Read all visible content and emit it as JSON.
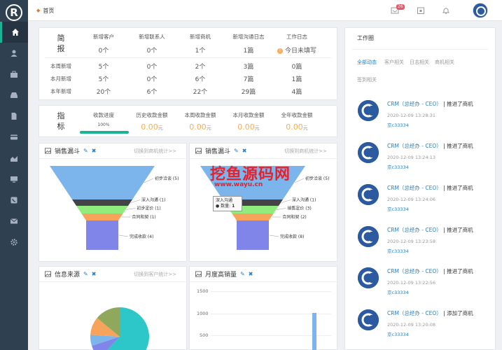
{
  "logo": "R",
  "nav": [
    "home-icon",
    "user-icon",
    "briefcase-icon",
    "inbox-icon",
    "document-icon",
    "credit-card-icon",
    "area-chart-icon",
    "monitor-icon",
    "phone-icon",
    "envelope-icon",
    "gear-icon"
  ],
  "topbar": {
    "home_tab": "首页",
    "badge": "26"
  },
  "summary": {
    "label": [
      "简",
      "报"
    ],
    "columns": [
      "新增客户",
      "新增联系人",
      "新增商机",
      "新增沟通日志",
      "工作日志"
    ],
    "today": [
      "0个",
      "0个",
      "1个",
      "1篇"
    ],
    "today_worklog": "今日未填写",
    "rows": [
      {
        "label": "本周新增",
        "values": [
          "5个",
          "0个",
          "2个",
          "3篇",
          "0篇"
        ]
      },
      {
        "label": "本月新增",
        "values": [
          "5个",
          "0个",
          "6个",
          "7篇",
          "1篇"
        ]
      },
      {
        "label": "本年新增",
        "values": [
          "20个",
          "6个",
          "22个",
          "29篇",
          "4篇"
        ]
      }
    ]
  },
  "indicators": {
    "label": [
      "指",
      "标"
    ],
    "columns": [
      "收款进度",
      "历史收款金额",
      "本周收款金额",
      "本月收款金额",
      "全年收款金额"
    ],
    "progress_text": "100%",
    "progress_fraction": 1.0,
    "values": [
      "0.00",
      "0.00",
      "0.00",
      "0.00"
    ],
    "unit": "元"
  },
  "funnel1": {
    "title": "销售漏斗",
    "link": "切换到商机统计>>",
    "stages": [
      {
        "label": "初步洽谈 (5)",
        "value": 5,
        "color": "#7cb5ec"
      },
      {
        "label": "深入沟通 (1)",
        "value": 1,
        "color": "#434348"
      },
      {
        "label": "初步定价 (1)",
        "value": 1,
        "color": "#90ed7d"
      },
      {
        "label": "合同和契 (1)",
        "value": 1,
        "color": "#f7a35c"
      },
      {
        "label": "完成收款 (4)",
        "value": 4,
        "color": "#8085e9"
      }
    ]
  },
  "funnel2": {
    "title": "销售漏斗",
    "link": "切换到商机统计>>",
    "stages": [
      {
        "label": "初步洽谈 (5)",
        "value": 5,
        "color": "#7cb5ec"
      },
      {
        "label": "深入沟通 (1)",
        "value": 1,
        "color": "#434348"
      },
      {
        "label": "销售定价 (3)",
        "value": 3,
        "color": "#90ed7d"
      },
      {
        "label": "合同和契 (2)",
        "value": 2,
        "color": "#f7a35c"
      },
      {
        "label": "完成收款 (8)",
        "value": 8,
        "color": "#8085e9"
      }
    ],
    "tooltip": {
      "title": "深入沟通",
      "label": "数量:",
      "value": "1"
    }
  },
  "watermark": {
    "title": "挖鱼源码网",
    "url": "www.wayu.cn"
  },
  "source": {
    "title": "信息来源",
    "link": "切换到客户统计>>",
    "pie": [
      {
        "value": 62,
        "color": "#2ec7c9"
      },
      {
        "value": 8,
        "color": "#8085e9"
      },
      {
        "value": 6,
        "color": "#7cb5ec"
      },
      {
        "value": 10,
        "color": "#f7a35c"
      },
      {
        "value": 14,
        "color": "#90a85c"
      }
    ]
  },
  "monthly": {
    "title": "月度高销量",
    "y_ticks": [
      "1500",
      "1000",
      "500"
    ]
  },
  "workspace": {
    "title": "工作圈",
    "tabs": [
      "全部动态",
      "客户相关",
      "日志相关",
      "商机相关",
      "签到相关"
    ],
    "feed": [
      {
        "who": "CRM（总经办 - CEO）",
        "action": "推进了商机",
        "time": "2020-12-09 13:28:31",
        "user": "京c33334"
      },
      {
        "who": "CRM（总经办 - CEO）",
        "action": "推进了商机",
        "time": "2020-12-09 13:24:13",
        "user": "京c33334"
      },
      {
        "who": "CRM（总经办 - CEO）",
        "action": "推进了商机",
        "time": "2020-12-09 13:24:06",
        "user": "京c33334"
      },
      {
        "who": "CRM（总经办 - CEO）",
        "action": "推进了商机",
        "time": "2020-12-09 13:23:58",
        "user": "京c33334"
      },
      {
        "who": "CRM（总经办 - CEO）",
        "action": "推进了商机",
        "time": "2020-12-09 13:22:56",
        "user": "京c33334"
      },
      {
        "who": "CRM（总经办 - CEO）",
        "action": "添加了商机",
        "time": "2020-12-09 13:20:08",
        "user": "京c33334"
      }
    ]
  }
}
